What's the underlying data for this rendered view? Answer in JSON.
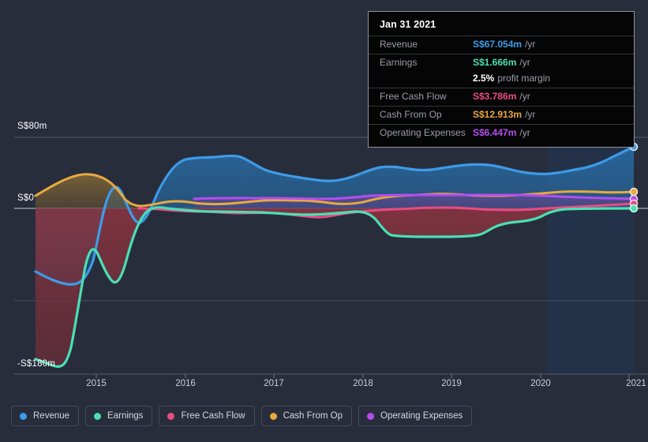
{
  "tooltip": {
    "title": "Jan 31 2021",
    "rows": [
      {
        "label": "Revenue",
        "value": "S$67.054m",
        "unit": "/yr",
        "color": "#3d9be9"
      },
      {
        "label": "Earnings",
        "value": "S$1.666m",
        "unit": "/yr",
        "color": "#4adfb4"
      },
      {
        "label": "",
        "value": "2.5%",
        "unit": "profit margin",
        "color": "#ffffff"
      },
      {
        "label": "Free Cash Flow",
        "value": "S$3.786m",
        "unit": "/yr",
        "color": "#eb4a83"
      },
      {
        "label": "Cash From Op",
        "value": "S$12.913m",
        "unit": "/yr",
        "color": "#e8a93f"
      },
      {
        "label": "Operating Expenses",
        "value": "S$6.447m",
        "unit": "/yr",
        "color": "#b44df0"
      }
    ]
  },
  "legend": {
    "items": [
      {
        "label": "Revenue",
        "color": "#3d9be9",
        "icon": "legend-dot-icon"
      },
      {
        "label": "Earnings",
        "color": "#4adfb4",
        "icon": "legend-dot-icon"
      },
      {
        "label": "Free Cash Flow",
        "color": "#eb4a83",
        "icon": "legend-dot-icon"
      },
      {
        "label": "Cash From Op",
        "color": "#e8a93f",
        "icon": "legend-dot-icon"
      },
      {
        "label": "Operating Expenses",
        "color": "#b44df0",
        "icon": "legend-dot-icon"
      }
    ]
  },
  "chart_data": {
    "type": "area",
    "title": "",
    "xlabel": "",
    "ylabel": "",
    "ylim": [
      -180,
      80
    ],
    "yticks": [
      80,
      0,
      -180
    ],
    "ytick_labels": [
      "S$80m",
      "S$0",
      "-S$180m"
    ],
    "grid": true,
    "legend_position": "bottom-left",
    "currency": "S$",
    "units": "m",
    "x": [
      2014.3,
      2014.5,
      2014.7,
      2014.9,
      2015.0,
      2015.2,
      2015.4,
      2015.6,
      2015.8,
      2016.0,
      2016.3,
      2016.6,
      2017.0,
      2017.3,
      2017.6,
      2018.0,
      2018.3,
      2018.6,
      2019.0,
      2019.3,
      2019.6,
      2020.0,
      2020.3,
      2020.6,
      2021.0
    ],
    "xticks": [
      2015,
      2016,
      2017,
      2018,
      2019,
      2020,
      2021
    ],
    "xtick_labels": [
      "2015",
      "2016",
      "2017",
      "2018",
      "2019",
      "2020",
      "2021"
    ],
    "forecast_start": 2020.1,
    "series": [
      {
        "name": "Revenue",
        "color": "#3d9be9",
        "values": [
          -100,
          -112,
          -118,
          -5,
          12,
          -8,
          -20,
          18,
          50,
          63,
          70,
          62,
          58,
          55,
          53,
          52,
          57,
          59,
          56,
          61,
          64,
          63,
          60,
          62,
          67.054
        ]
      },
      {
        "name": "Earnings",
        "color": "#4adfb4",
        "values": [
          -168,
          -176,
          -178,
          -172,
          -90,
          -62,
          -88,
          -100,
          -10,
          -4,
          -3,
          -4,
          -5,
          -6,
          -8,
          -7,
          -9,
          -26,
          -28,
          -27,
          -20,
          -18,
          -17,
          -4,
          1.666
        ]
      },
      {
        "name": "Free Cash Flow",
        "color": "#eb4a83",
        "values": [
          0,
          0,
          0,
          0,
          -1,
          -2,
          -3,
          -4,
          -5,
          -5,
          -6,
          -7,
          -6,
          -7,
          -9,
          -7,
          -6,
          -5,
          -4,
          -4,
          -3,
          -3,
          -3,
          2,
          3.786
        ]
      },
      {
        "name": "Cash From Op",
        "color": "#e8a93f",
        "values": [
          12,
          26,
          32,
          22,
          8,
          4,
          2,
          2,
          3,
          4,
          4,
          5,
          5,
          6,
          5,
          7,
          9,
          8,
          8,
          11,
          10,
          9,
          10,
          11,
          12.913
        ]
      },
      {
        "name": "Operating Expenses",
        "color": "#b44df0",
        "values": [
          null,
          null,
          null,
          null,
          null,
          null,
          null,
          6,
          7,
          7,
          7,
          7,
          7,
          7,
          7,
          8,
          8,
          8,
          8,
          8,
          8,
          8,
          7,
          7,
          6.447
        ]
      }
    ]
  }
}
